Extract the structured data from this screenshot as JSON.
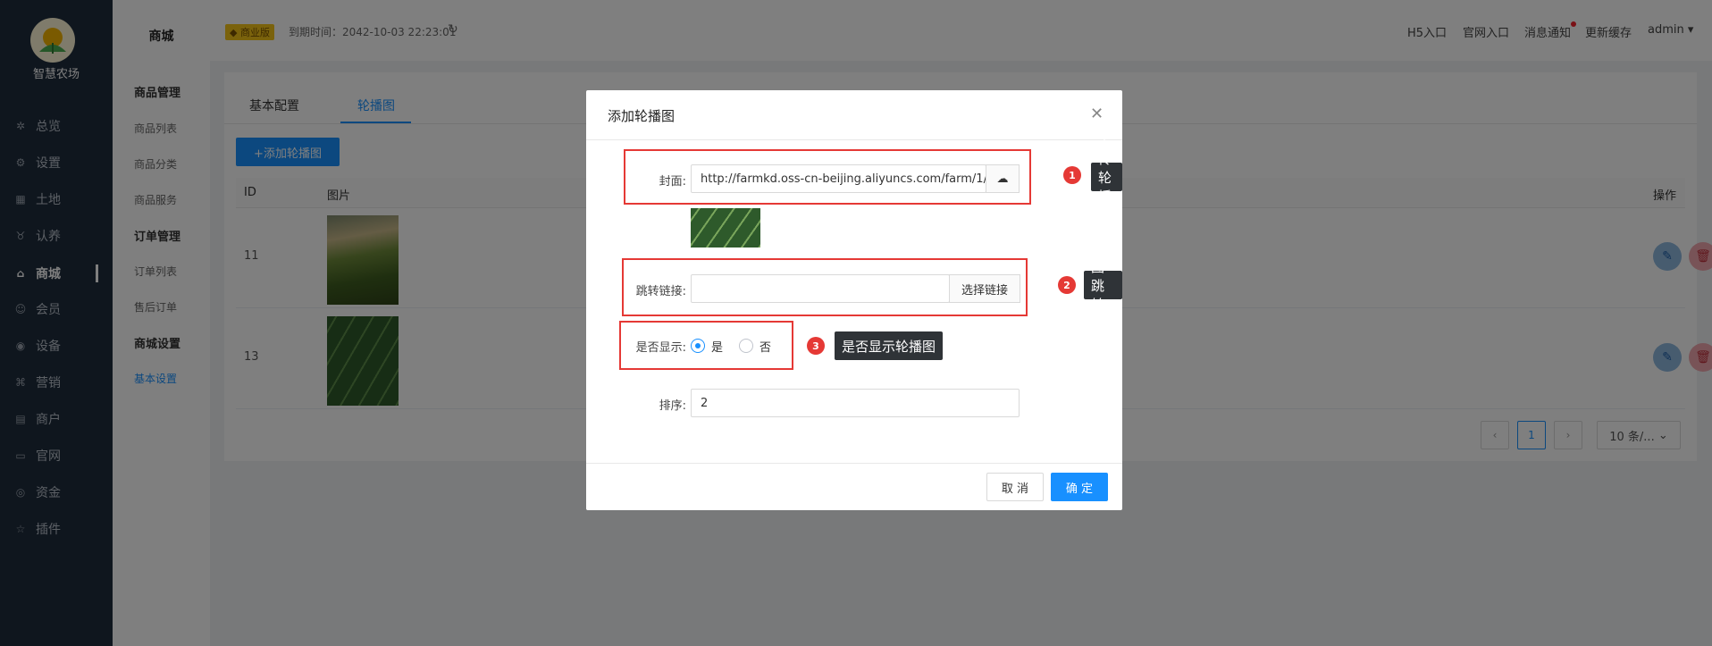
{
  "sidebar": {
    "logo_text": "智慧农场",
    "items": [
      {
        "label": "总览",
        "icon": "dashboard-icon"
      },
      {
        "label": "设置",
        "icon": "gear-icon"
      },
      {
        "label": "土地",
        "icon": "grid-icon"
      },
      {
        "label": "认养",
        "icon": "handshake-icon"
      },
      {
        "label": "商城",
        "icon": "shop-icon"
      },
      {
        "label": "会员",
        "icon": "member-icon"
      },
      {
        "label": "设备",
        "icon": "location-icon"
      },
      {
        "label": "营销",
        "icon": "marketing-icon"
      },
      {
        "label": "商户",
        "icon": "merchant-icon"
      },
      {
        "label": "官网",
        "icon": "website-icon"
      },
      {
        "label": "资金",
        "icon": "fund-icon"
      },
      {
        "label": "插件",
        "icon": "star-icon"
      }
    ],
    "active_index": 4
  },
  "submenu": {
    "title": "商城",
    "groups": [
      {
        "label": "商品管理",
        "items": [
          "商品列表",
          "商品分类",
          "商品服务"
        ]
      },
      {
        "label": "订单管理",
        "items": [
          "订单列表",
          "售后订单"
        ]
      },
      {
        "label": "商城设置",
        "items": [
          "基本设置"
        ]
      }
    ],
    "active_item": "基本设置"
  },
  "header": {
    "version_badge": "商业版",
    "expire_text": "到期时间：2042-10-03 22:23:01",
    "links": [
      "H5入口",
      "官网入口",
      "消息通知",
      "更新缓存",
      "admin"
    ]
  },
  "main": {
    "tabs": [
      "基本配置",
      "轮播图"
    ],
    "active_tab": "轮播图",
    "add_button": "+添加轮播图",
    "columns": [
      "ID",
      "图片",
      "操作"
    ],
    "rows": [
      {
        "id": "11"
      },
      {
        "id": "13"
      }
    ],
    "pagination": {
      "current": "1",
      "page_size": "10 条/..."
    }
  },
  "modal": {
    "title": "添加轮播图",
    "cover_label": "封面:",
    "cover_value": "http://farmkd.oss-cn-beijing.aliyuncs.com/farm/1/",
    "link_label": "跳转链接:",
    "link_value": "",
    "link_button": "选择链接",
    "show_label": "是否显示:",
    "show_yes": "是",
    "show_no": "否",
    "show_selected": "是",
    "sort_label": "排序:",
    "sort_value": "2",
    "cancel": "取 消",
    "ok": "确 定"
  },
  "annotations": [
    {
      "num": "1",
      "text": "上传轮播图"
    },
    {
      "num": "2",
      "text": "轮播图跳转链接"
    },
    {
      "num": "3",
      "text": "是否显示轮播图"
    }
  ],
  "colors": {
    "primary": "#1890ff",
    "sidebar": "#1f2d3d",
    "highlight": "#e53935"
  }
}
